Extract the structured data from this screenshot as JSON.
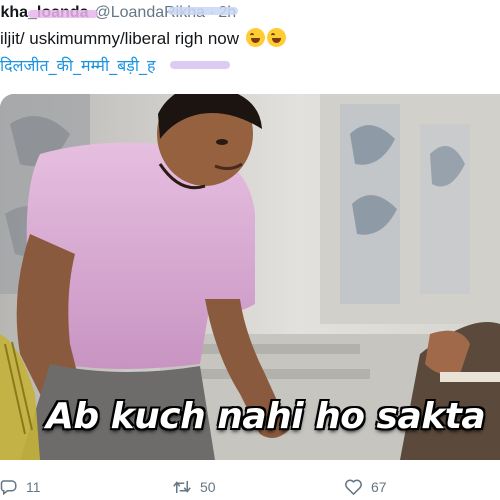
{
  "tweet": {
    "display_name": "ikha_loanda",
    "handle": "@LoandaRikha",
    "separator": "·",
    "time": "2h",
    "text_line1": "iljit/ uskimummy/liberal righ now",
    "hashtag_line": "दिलजीत_की_मम्मी_बड़ी_ह"
  },
  "media": {
    "caption": "Ab kuch nahi ho sakta"
  },
  "actions": {
    "reply_count": "11",
    "retweet_count": "50",
    "like_count": "67"
  },
  "icons": {
    "emoji": "rolling-on-floor-laughing-emoji",
    "reply": "reply-icon",
    "retweet": "retweet-icon",
    "like": "heart-icon"
  },
  "colors": {
    "link": "#1b95e0",
    "muted": "#657786",
    "text": "#14171a"
  }
}
